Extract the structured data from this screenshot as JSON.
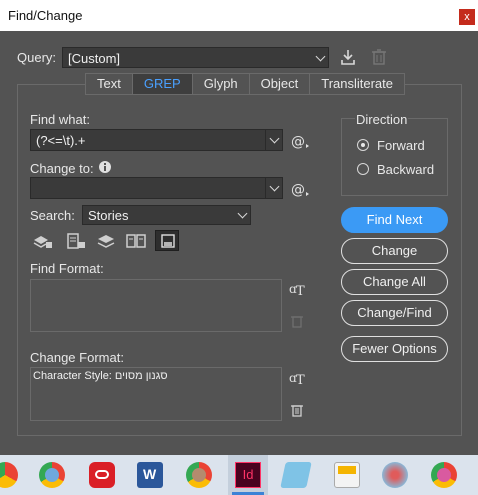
{
  "window": {
    "title": "Find/Change",
    "close_glyph": "x"
  },
  "query": {
    "label": "Query:",
    "value": "[Custom]"
  },
  "tabs": [
    "Text",
    "GREP",
    "Glyph",
    "Object",
    "Transliterate"
  ],
  "active_tab": "GREP",
  "find_what": {
    "label": "Find what:",
    "value": "(?<=\\t).+"
  },
  "change_to": {
    "label": "Change to:",
    "value": ""
  },
  "search": {
    "label": "Search:",
    "value": "Stories"
  },
  "find_format": {
    "label": "Find Format:",
    "value": ""
  },
  "change_format": {
    "label": "Change Format:",
    "value": "Character Style: סגנון מסוים"
  },
  "direction": {
    "label": "Direction",
    "forward": "Forward",
    "backward": "Backward",
    "selected": "Forward"
  },
  "buttons": {
    "find_next": "Find Next",
    "change": "Change",
    "change_all": "Change All",
    "change_find": "Change/Find",
    "fewer_options": "Fewer Options"
  },
  "colors": {
    "accent": "#3b9af5",
    "active_tab_text": "#4aa0ff",
    "dialog_bg": "#535353"
  },
  "taskbar_icons": [
    "chrome-icon",
    "chrome-profile-icon",
    "creative-cloud-icon",
    "word-icon",
    "chrome-profile-icon",
    "indesign-icon",
    "notepad-icon",
    "calendar-icon",
    "paint-icon",
    "chrome-profile-icon"
  ],
  "taskbar": {
    "indesign_label": "Id",
    "word_label": "W"
  }
}
